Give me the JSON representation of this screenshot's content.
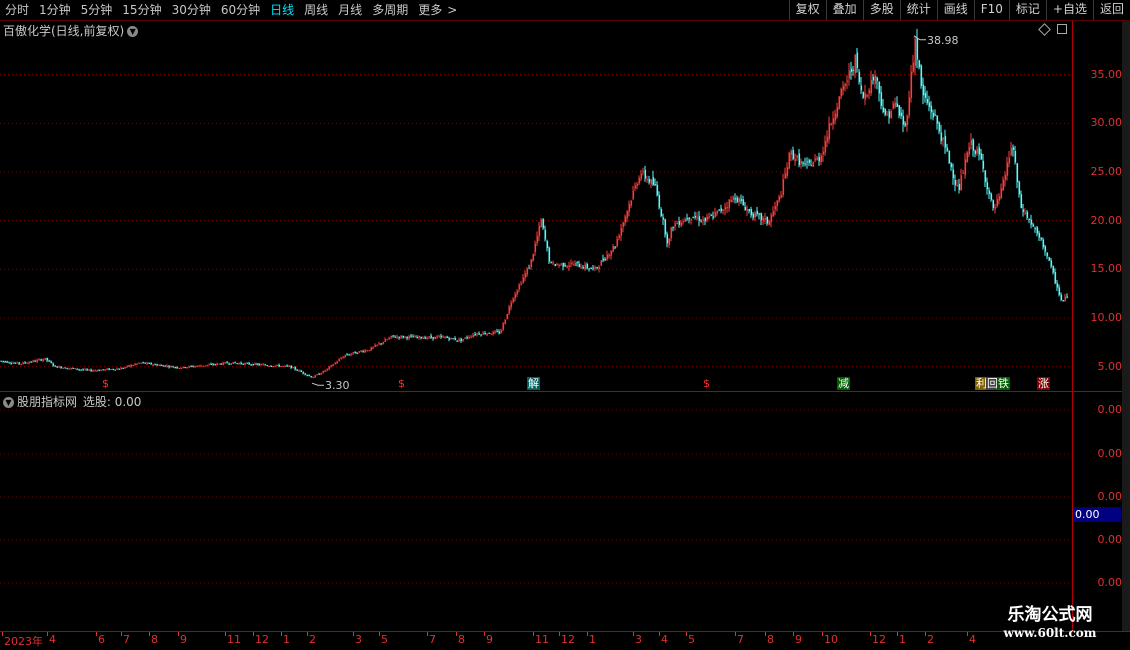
{
  "toolbar": {
    "periods": [
      "分时",
      "1分钟",
      "5分钟",
      "15分钟",
      "30分钟",
      "60分钟",
      "日线",
      "周线",
      "月线",
      "多周期",
      "更多"
    ],
    "active_period": "日线",
    "more_chevron": ">",
    "buttons": [
      "复权",
      "叠加",
      "多股",
      "统计",
      "画线",
      "F10",
      "标记",
      "+自选",
      "返回"
    ]
  },
  "main_panel": {
    "title": "百傲化学(日线,前复权)",
    "y_ticks": [
      "35.00",
      "30.00",
      "25.00",
      "20.00",
      "15.00",
      "10.00",
      "5.00"
    ],
    "high_label": "38.98",
    "low_label": "3.30"
  },
  "markers": [
    {
      "text": "$",
      "color": "#ff3030",
      "bg": "#000"
    },
    {
      "text": "$",
      "color": "#ff3030",
      "bg": "#000"
    },
    {
      "text": "解",
      "color": "#fff",
      "bg": "#006060"
    },
    {
      "text": "$",
      "color": "#ff3030",
      "bg": "#000"
    },
    {
      "text": "减",
      "color": "#fff",
      "bg": "#006000"
    },
    {
      "text": "利",
      "color": "#fff",
      "bg": "#806000"
    },
    {
      "text": "回",
      "color": "#fff",
      "bg": "#404040"
    },
    {
      "text": "铁",
      "color": "#fff",
      "bg": "#006000"
    },
    {
      "text": "涨",
      "color": "#fff",
      "bg": "#800000"
    }
  ],
  "indicator_panel": {
    "title": "股朋指标网",
    "sub_label": "选股:",
    "sub_value": "0.00",
    "y_ticks": [
      "0.00",
      "0.00",
      "0.00",
      "0.00",
      "0.00"
    ],
    "current_value": "0.00"
  },
  "x_axis": {
    "labels": [
      "2023年",
      "4",
      "6",
      "7",
      "8",
      "9",
      "11",
      "12",
      "1",
      "2",
      "3",
      "5",
      "7",
      "8",
      "9",
      "11",
      "12",
      "1",
      "3",
      "4",
      "5",
      "7",
      "8",
      "9",
      "10",
      "12",
      "1",
      "2",
      "4"
    ]
  },
  "watermark": {
    "cn": "乐淘公式网",
    "url": "www.60lt.com"
  },
  "colors": {
    "up": "#ff3c3c",
    "down": "#54ffff",
    "grid": "#7a0000",
    "axis": "#b00000"
  },
  "chart_data": {
    "type": "candlestick",
    "title": "百傲化学(日线,前复权)",
    "ylim": [
      2.5,
      40.5
    ],
    "y_ticks": [
      5,
      10,
      15,
      20,
      25,
      30,
      35
    ],
    "annotations": [
      {
        "label": "38.98",
        "value": 38.98
      },
      {
        "label": "3.30",
        "value": 3.3
      }
    ],
    "price_path": [
      [
        0,
        5.6
      ],
      [
        20,
        5.3
      ],
      [
        45,
        5.8
      ],
      [
        55,
        5.0
      ],
      [
        90,
        4.6
      ],
      [
        120,
        4.8
      ],
      [
        140,
        5.4
      ],
      [
        180,
        4.9
      ],
      [
        230,
        5.4
      ],
      [
        290,
        5.0
      ],
      [
        312,
        3.9
      ],
      [
        325,
        4.6
      ],
      [
        345,
        6.2
      ],
      [
        370,
        6.8
      ],
      [
        392,
        8.1
      ],
      [
        420,
        8.0
      ],
      [
        445,
        8.0
      ],
      [
        460,
        7.7
      ],
      [
        475,
        8.4
      ],
      [
        500,
        8.5
      ],
      [
        512,
        12.0
      ],
      [
        530,
        15.5
      ],
      [
        541,
        20.0
      ],
      [
        550,
        15.5
      ],
      [
        575,
        15.5
      ],
      [
        595,
        15.0
      ],
      [
        615,
        17.5
      ],
      [
        630,
        22.0
      ],
      [
        640,
        25.0
      ],
      [
        655,
        23.5
      ],
      [
        668,
        17.5
      ],
      [
        672,
        19.5
      ],
      [
        690,
        20.5
      ],
      [
        705,
        20.0
      ],
      [
        720,
        21.0
      ],
      [
        735,
        22.5
      ],
      [
        750,
        20.8
      ],
      [
        768,
        19.8
      ],
      [
        780,
        22.5
      ],
      [
        790,
        27.0
      ],
      [
        805,
        25.5
      ],
      [
        820,
        26.5
      ],
      [
        835,
        31.5
      ],
      [
        855,
        36.5
      ],
      [
        862,
        32.5
      ],
      [
        875,
        35.0
      ],
      [
        885,
        30.5
      ],
      [
        895,
        32.0
      ],
      [
        905,
        29.5
      ],
      [
        915,
        38.5
      ],
      [
        922,
        33.0
      ],
      [
        935,
        30.5
      ],
      [
        948,
        26.5
      ],
      [
        958,
        23.0
      ],
      [
        970,
        28.0
      ],
      [
        980,
        26.5
      ],
      [
        993,
        21.0
      ],
      [
        1000,
        22.5
      ],
      [
        1012,
        28.0
      ],
      [
        1020,
        21.5
      ],
      [
        1032,
        19.5
      ],
      [
        1045,
        17.0
      ],
      [
        1062,
        11.5
      ],
      [
        1068,
        12.5
      ]
    ]
  }
}
